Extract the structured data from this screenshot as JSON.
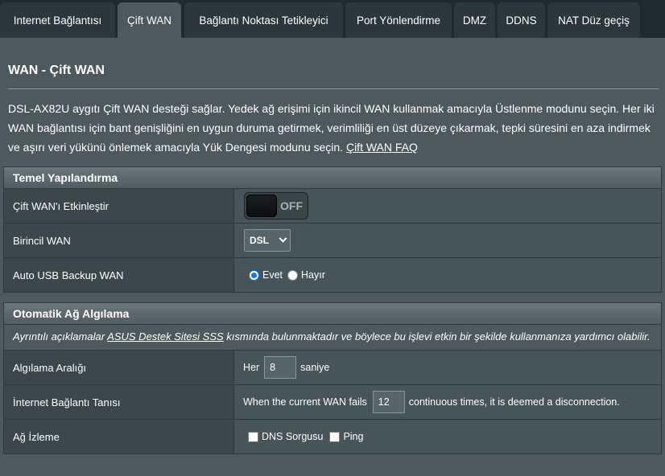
{
  "tabs": [
    {
      "label": "Internet Bağlantısı"
    },
    {
      "label": "Çift WAN"
    },
    {
      "label": "Bağlantı Noktası Tetikleyici"
    },
    {
      "label": "Port Yönlendirme"
    },
    {
      "label": "DMZ"
    },
    {
      "label": "DDNS"
    },
    {
      "label": "NAT Düz geçiş"
    }
  ],
  "page": {
    "title": "WAN - Çift WAN",
    "description": "DSL-AX82U aygıtı Çift WAN desteği sağlar. Yedek ağ erişimi için ikincil WAN kullanmak amacıyla Üstlenme modunu seçin. Her iki WAN bağlantısı için bant genişliğini en uygun duruma getirmek, verimliliği en üst düzeye çıkarmak, tepki süresini en aza indirmek ve aşırı veri yükünü önlemek amacıyla Yük Dengesi modunu seçin.",
    "faq_link": "Çift WAN FAQ"
  },
  "basic": {
    "header": "Temel Yapılandırma",
    "enable_label": "Çift WAN'ı Etkinleştir",
    "enable_state": "OFF",
    "primary_label": "Birincil WAN",
    "primary_value": "DSL",
    "usb_label": "Auto USB Backup WAN",
    "usb_yes": "Evet",
    "usb_no": "Hayır"
  },
  "detect": {
    "header": "Otomatik Ağ Algılama",
    "note_prefix": "Ayrıntılı açıklamalar",
    "note_link": "ASUS Destek Sitesi SSS",
    "note_suffix": "kısmında bulunmaktadır ve böylece bu işlevi etkin bir şekilde kullanmanıza yardımcı olabilir.",
    "interval_label": "Algılama Aralığı",
    "interval_prefix": "Her",
    "interval_value": "8",
    "interval_suffix": "saniye",
    "disconnect_label": "İnternet Bağlantı Tanısı",
    "disconnect_prefix": "When the current WAN fails",
    "disconnect_value": "12",
    "disconnect_suffix": "continuous times, it is deemed a disconnection.",
    "monitor_label": "Ağ İzleme",
    "monitor_dns": "DNS Sorgusu",
    "monitor_ping": "Ping"
  }
}
